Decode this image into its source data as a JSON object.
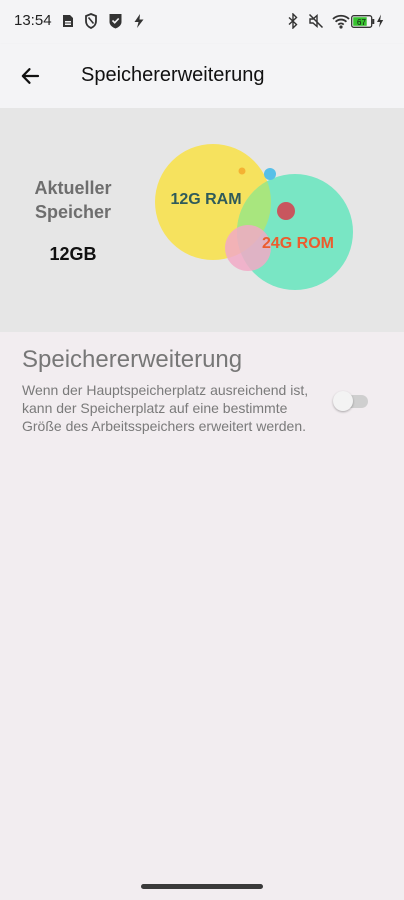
{
  "status_bar": {
    "time": "13:54",
    "battery": "67",
    "icons": [
      "sim-icon",
      "shield-icon",
      "security-check-icon",
      "flash-icon",
      "bluetooth-icon",
      "mute-icon",
      "wifi-icon",
      "battery-icon",
      "charging-icon"
    ]
  },
  "appbar": {
    "title": "Speichererweiterung",
    "back_icon": "back-arrow-icon"
  },
  "hero": {
    "label": "Aktueller Speicher",
    "value": "12GB",
    "ram_label": "12G RAM",
    "rom_label": "24G ROM",
    "colors": {
      "ram_bubble": "#f6e25e",
      "rom_bubble": "#79e6c4",
      "overlap": "#a8e67e",
      "pink_bubble": "#f1a9c6",
      "red_dot": "#c8565e",
      "blue_dot": "#57c0e8",
      "orange_dot": "#f4b233",
      "ram_text": "#2f5b5a",
      "rom_text": "#ec5c2e"
    }
  },
  "setting": {
    "title": "Speichererweiterung",
    "description": "Wenn der Hauptspeicherplatz ausreichend ist, kann der Speicherplatz auf eine bestimmte Größe des Arbeitsspeichers erweitert werden.",
    "toggle_on": false
  }
}
